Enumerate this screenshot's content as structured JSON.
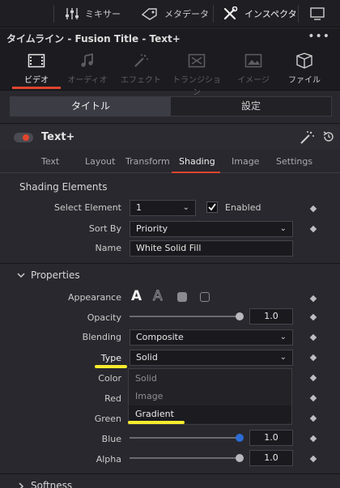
{
  "toolbar": {
    "mixer_label": "ミキサー",
    "metadata_label": "メタデータ",
    "inspector_label": "インスペクタ"
  },
  "header": {
    "title": "タイムライン - Fusion Title - Text+",
    "more": "•••"
  },
  "categories": [
    {
      "label": "ビデオ",
      "icon": "film-icon"
    },
    {
      "label": "オーディオ",
      "icon": "music-note-icon"
    },
    {
      "label": "エフェクト",
      "icon": "magic-wand-icon"
    },
    {
      "label": "トランジション",
      "icon": "transition-icon"
    },
    {
      "label": "イメージ",
      "icon": "image-icon"
    },
    {
      "label": "ファイル",
      "icon": "file-icon"
    }
  ],
  "segments": {
    "title": "タイトル",
    "settings": "設定"
  },
  "node": {
    "name": "Text+"
  },
  "subtabs": [
    "Text",
    "Layout",
    "Transform",
    "Shading",
    "Image",
    "Settings"
  ],
  "shading_elements": {
    "heading": "Shading Elements",
    "select_element_label": "Select Element",
    "select_element_value": "1",
    "enabled_label": "Enabled",
    "sort_by_label": "Sort By",
    "sort_by_value": "Priority",
    "name_label": "Name",
    "name_value": "White Solid Fill"
  },
  "properties": {
    "heading": "Properties",
    "appearance_label": "Appearance",
    "appearance_text_icon": "A",
    "appearance_outline_icon": "A",
    "opacity_label": "Opacity",
    "opacity_value": "1.0",
    "opacity_level": 1.0,
    "blending_label": "Blending",
    "blending_value": "Composite",
    "type_label": "Type",
    "type_value": "Solid",
    "type_options": [
      "Solid",
      "Image",
      "Gradient"
    ],
    "color_label": "Color",
    "red_label": "Red",
    "green_label": "Green",
    "blue_label": "Blue",
    "blue_value": "1.0",
    "blue_level": 1.0,
    "alpha_label": "Alpha",
    "alpha_value": "1.0",
    "alpha_level": 1.0
  },
  "softness": {
    "heading": "Softness"
  },
  "colors": {
    "accent": "#e0452e",
    "highlight": "#f7ec2d",
    "slider_blue": "#2d6cd6"
  }
}
